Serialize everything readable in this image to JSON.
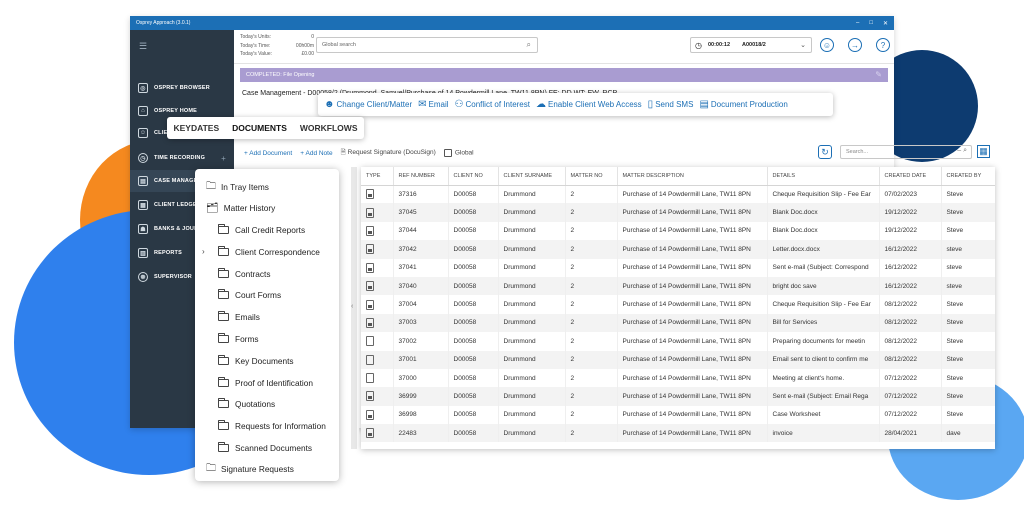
{
  "window": {
    "title": "Osprey Approach (3.0.1)",
    "controls": [
      "–",
      "□",
      "✕"
    ]
  },
  "sidebar": {
    "items": [
      {
        "label": "OSPREY BROWSER",
        "icon": "globe-icon",
        "glyph": "◎"
      },
      {
        "label": "OSPREY HOME",
        "icon": "home-icon",
        "glyph": "⌂"
      },
      {
        "label": "CLIENT",
        "icon": "clients-icon",
        "glyph": "☺"
      },
      {
        "label": "TIME RECORDING",
        "icon": "clock-icon",
        "glyph": "◷"
      },
      {
        "label": "CASE MANAGEMENT",
        "icon": "case-icon",
        "glyph": "▤"
      },
      {
        "label": "CLIENT LEDGERS",
        "icon": "ledger-icon",
        "glyph": "▦"
      },
      {
        "label": "BANKS & JOURN",
        "icon": "bank-icon",
        "glyph": "☗"
      },
      {
        "label": "REPORTS",
        "icon": "reports-icon",
        "glyph": "▥"
      },
      {
        "label": "SUPERVISOR",
        "icon": "supervisor-icon",
        "glyph": "☸"
      }
    ]
  },
  "topbar": {
    "units_labels": [
      "Today's Units:",
      "Today's Time:",
      "Today's Value:"
    ],
    "units_values": [
      "0",
      "00h00m",
      "£0.00"
    ],
    "search_placeholder": "Global search",
    "timer": "00:00:12",
    "matter": "A00018/2"
  },
  "status": {
    "text": "COMPLETED: File Opening"
  },
  "case_header": "Case Management - D00058/2 (Drummond, Samuel/Purchase of 14 Powdermill Lane, TW11 8PN) FE: DD WT: EW, RCP",
  "actions": [
    {
      "label": "Change Client/Matter",
      "icon": "people-icon",
      "glyph": "☻"
    },
    {
      "label": "Email",
      "icon": "email-icon",
      "glyph": "✉"
    },
    {
      "label": "Conflict of Interest",
      "icon": "conflict-icon",
      "glyph": "⚇"
    },
    {
      "label": "Enable Client Web Access",
      "icon": "cloud-icon",
      "glyph": "☁"
    },
    {
      "label": "Send SMS",
      "icon": "phone-icon",
      "glyph": "▯"
    },
    {
      "label": "Document Production",
      "icon": "document-icon",
      "glyph": "▤"
    }
  ],
  "tabs": [
    "KEYDATES",
    "DOCUMENTS",
    "WORKFLOWS"
  ],
  "docs_toolbar": {
    "add_document": "+ Add Document",
    "add_note": "+ Add Note",
    "request_signature": "Request Signature (DocuSign)",
    "global": "Global",
    "search_placeholder": "Search..."
  },
  "tree": {
    "in_tray": "In Tray Items",
    "matter_history": "Matter History",
    "folders": [
      "Call Credit Reports",
      "Client Correspondence",
      "Contracts",
      "Court Forms",
      "Emails",
      "Forms",
      "Key Documents",
      "Proof of Identification",
      "Quotations",
      "Requests for Information",
      "Scanned Documents"
    ],
    "signature_requests": "Signature Requests"
  },
  "table": {
    "columns": [
      "TYPE",
      "REF NUMBER",
      "CLIENT NO",
      "CLIENT SURNAME",
      "MATTER NO",
      "MATTER DESCRIPTION",
      "DETAILS",
      "CREATED DATE",
      "CREATED BY"
    ],
    "rows": [
      {
        "type": "dark",
        "ref": "37316",
        "client_no": "D00058",
        "surname": "Drummond",
        "matter": "2",
        "desc": "Purchase of 14 Powdermill Lane, TW11 8PN",
        "details": "Cheque Requisition Slip - Fee Ear",
        "date": "07/02/2023",
        "by": "Steve"
      },
      {
        "type": "dark",
        "ref": "37045",
        "client_no": "D00058",
        "surname": "Drummond",
        "matter": "2",
        "desc": "Purchase of 14 Powdermill Lane, TW11 8PN",
        "details": "Blank Doc.docx",
        "date": "19/12/2022",
        "by": "Steve"
      },
      {
        "type": "dark",
        "ref": "37044",
        "client_no": "D00058",
        "surname": "Drummond",
        "matter": "2",
        "desc": "Purchase of 14 Powdermill Lane, TW11 8PN",
        "details": "Blank Doc.docx",
        "date": "19/12/2022",
        "by": "Steve"
      },
      {
        "type": "dark",
        "ref": "37042",
        "client_no": "D00058",
        "surname": "Drummond",
        "matter": "2",
        "desc": "Purchase of 14 Powdermill Lane, TW11 8PN",
        "details": "Letter.docx.docx",
        "date": "16/12/2022",
        "by": "steve"
      },
      {
        "type": "dark",
        "ref": "37041",
        "client_no": "D00058",
        "surname": "Drummond",
        "matter": "2",
        "desc": "Purchase of 14 Powdermill Lane, TW11 8PN",
        "details": "Sent e-mail (Subject: Correspond",
        "date": "16/12/2022",
        "by": "steve"
      },
      {
        "type": "dark",
        "ref": "37040",
        "client_no": "D00058",
        "surname": "Drummond",
        "matter": "2",
        "desc": "Purchase of 14 Powdermill Lane, TW11 8PN",
        "details": "bright doc save",
        "date": "16/12/2022",
        "by": "steve"
      },
      {
        "type": "dark",
        "ref": "37004",
        "client_no": "D00058",
        "surname": "Drummond",
        "matter": "2",
        "desc": "Purchase of 14 Powdermill Lane, TW11 8PN",
        "details": "Cheque Requisition Slip - Fee Ear",
        "date": "08/12/2022",
        "by": "Steve"
      },
      {
        "type": "dark",
        "ref": "37003",
        "client_no": "D00058",
        "surname": "Drummond",
        "matter": "2",
        "desc": "Purchase of 14 Powdermill Lane, TW11 8PN",
        "details": "Bill for Services",
        "date": "08/12/2022",
        "by": "Steve"
      },
      {
        "type": "blank",
        "ref": "37002",
        "client_no": "D00058",
        "surname": "Drummond",
        "matter": "2",
        "desc": "Purchase of 14 Powdermill Lane, TW11 8PN",
        "details": "Preparing documents for meetin",
        "date": "08/12/2022",
        "by": "Steve"
      },
      {
        "type": "blank",
        "ref": "37001",
        "client_no": "D00058",
        "surname": "Drummond",
        "matter": "2",
        "desc": "Purchase of 14 Powdermill Lane, TW11 8PN",
        "details": "Email sent to client to confirm me",
        "date": "08/12/2022",
        "by": "Steve"
      },
      {
        "type": "blank",
        "ref": "37000",
        "client_no": "D00058",
        "surname": "Drummond",
        "matter": "2",
        "desc": "Purchase of 14 Powdermill Lane, TW11 8PN",
        "details": "Meeting at client's home.",
        "date": "07/12/2022",
        "by": "Steve"
      },
      {
        "type": "dark",
        "ref": "36999",
        "client_no": "D00058",
        "surname": "Drummond",
        "matter": "2",
        "desc": "Purchase of 14 Powdermill Lane, TW11 8PN",
        "details": "Sent e-mail (Subject: Email Rega",
        "date": "07/12/2022",
        "by": "Steve"
      },
      {
        "type": "dark",
        "ref": "36998",
        "client_no": "D00058",
        "surname": "Drummond",
        "matter": "2",
        "desc": "Purchase of 14 Powdermill Lane, TW11 8PN",
        "details": "Case Worksheet",
        "date": "07/12/2022",
        "by": "Steve"
      },
      {
        "type": "dark",
        "ref": "22483",
        "client_no": "D00058",
        "surname": "Drummond",
        "matter": "2",
        "desc": "Purchase of 14 Powdermill Lane, TW11 8PN",
        "details": "invoice",
        "date": "28/04/2021",
        "by": "dave"
      }
    ]
  },
  "colors": {
    "brand_blue": "#1c6fb5",
    "sidebar_bg": "#2a3845",
    "status_purple": "#a99cd1",
    "blob_navy": "#0d3b70",
    "blob_orange": "#f5891f",
    "blob_blue": "#2f80ed"
  }
}
